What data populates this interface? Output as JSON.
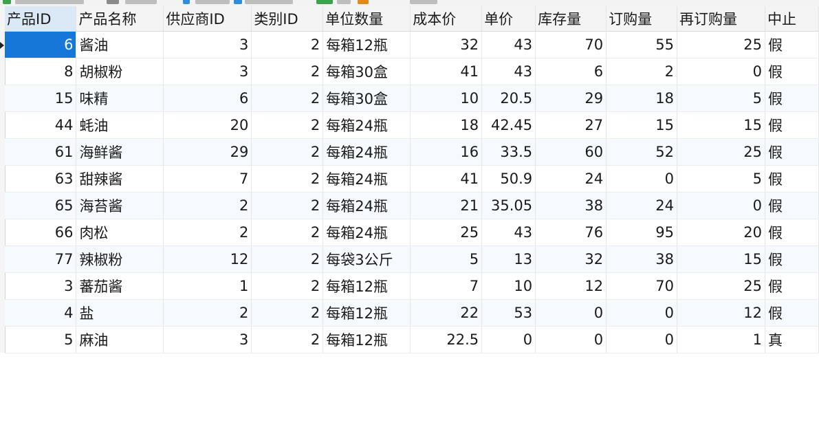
{
  "columns": [
    "产品ID",
    "产品名称",
    "供应商ID",
    "类别ID",
    "单位数量",
    "成本价",
    "单价",
    "库存量",
    "订购量",
    "再订购量",
    "中止"
  ],
  "rows": [
    [
      "6",
      "酱油",
      "3",
      "2",
      "每箱12瓶",
      "32",
      "43",
      "70",
      "55",
      "25",
      "假"
    ],
    [
      "8",
      "胡椒粉",
      "3",
      "2",
      "每箱30盒",
      "41",
      "43",
      "6",
      "2",
      "0",
      "假"
    ],
    [
      "15",
      "味精",
      "6",
      "2",
      "每箱30盒",
      "10",
      "20.5",
      "29",
      "18",
      "5",
      "假"
    ],
    [
      "44",
      "蚝油",
      "20",
      "2",
      "每箱24瓶",
      "18",
      "42.45",
      "27",
      "15",
      "15",
      "假"
    ],
    [
      "61",
      "海鲜酱",
      "29",
      "2",
      "每箱24瓶",
      "16",
      "33.5",
      "60",
      "52",
      "25",
      "假"
    ],
    [
      "63",
      "甜辣酱",
      "7",
      "2",
      "每箱24瓶",
      "41",
      "50.9",
      "24",
      "0",
      "5",
      "假"
    ],
    [
      "65",
      "海苔酱",
      "2",
      "2",
      "每箱24瓶",
      "21",
      "35.05",
      "38",
      "24",
      "0",
      "假"
    ],
    [
      "66",
      "肉松",
      "2",
      "2",
      "每箱24瓶",
      "25",
      "43",
      "76",
      "95",
      "20",
      "假"
    ],
    [
      "77",
      "辣椒粉",
      "12",
      "2",
      "每袋3公斤",
      "5",
      "13",
      "32",
      "38",
      "15",
      "假"
    ],
    [
      "3",
      "蕃茄酱",
      "1",
      "2",
      "每箱12瓶",
      "7",
      "10",
      "12",
      "70",
      "25",
      "假"
    ],
    [
      "4",
      "盐",
      "2",
      "2",
      "每箱12瓶",
      "22",
      "53",
      "0",
      "0",
      "12",
      "假"
    ],
    [
      "5",
      "麻油",
      "3",
      "2",
      "每箱12瓶",
      "22.5",
      "0",
      "0",
      "0",
      "1",
      "真"
    ]
  ],
  "colors": {
    "selected_cell": "#1677d8",
    "selected_header": "#dbe8f6",
    "row_alt": "#f6f9fd"
  }
}
